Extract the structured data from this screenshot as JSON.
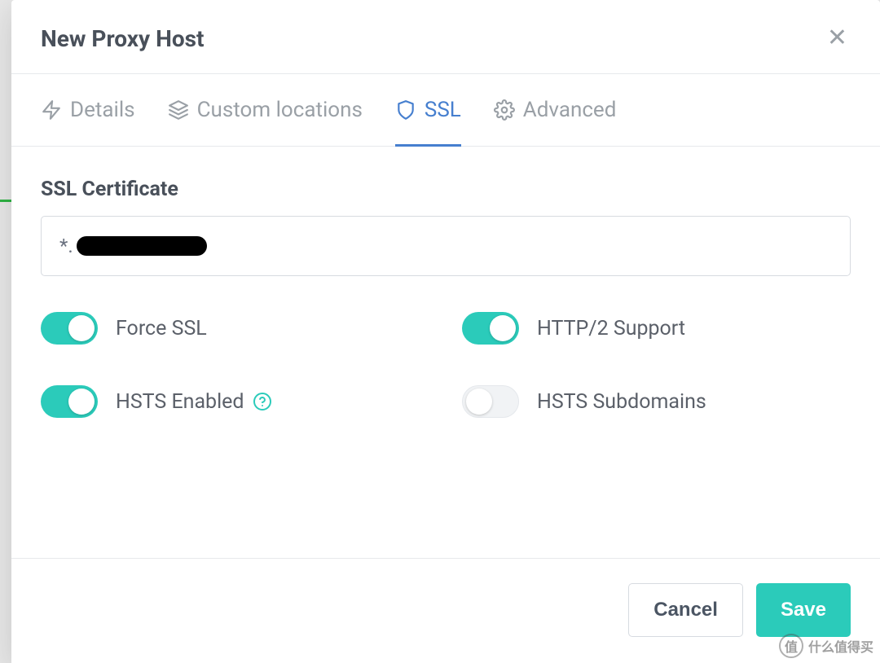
{
  "modal": {
    "title": "New Proxy Host"
  },
  "tabs": {
    "details": "Details",
    "custom_locations": "Custom locations",
    "ssl": "SSL",
    "advanced": "Advanced"
  },
  "ssl": {
    "certificate_label": "SSL Certificate",
    "certificate_value_prefix": "*.",
    "toggles": {
      "force_ssl": {
        "label": "Force SSL",
        "on": true
      },
      "http2_support": {
        "label": "HTTP/2 Support",
        "on": true
      },
      "hsts_enabled": {
        "label": "HSTS Enabled",
        "on": true
      },
      "hsts_subdomains": {
        "label": "HSTS Subdomains",
        "on": false
      }
    }
  },
  "footer": {
    "cancel": "Cancel",
    "save": "Save"
  },
  "watermark": {
    "glyph": "值",
    "text": "什么值得买"
  }
}
